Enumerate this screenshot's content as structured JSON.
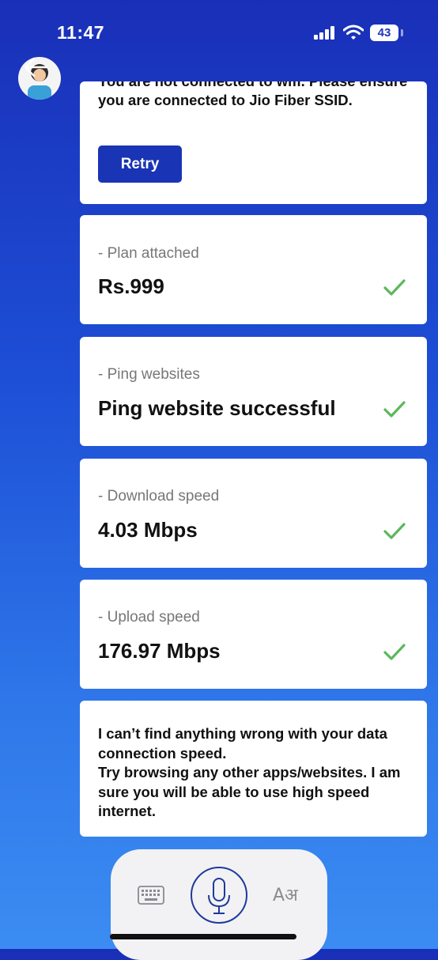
{
  "status_bar": {
    "time": "11:47",
    "battery": "43"
  },
  "colors": {
    "accent": "#1934b4",
    "check": "#5cb85c",
    "label": "#777777"
  },
  "wifi_card": {
    "message": "You are not connected to wifi. Please ensure you are connected to Jio Fiber SSID.",
    "retry_label": "Retry"
  },
  "checks": [
    {
      "label": "- Plan attached",
      "value": "Rs.999",
      "status": "checkmark-icon"
    },
    {
      "label": "- Ping websites",
      "value": "Ping website successful",
      "status": "checkmark-icon"
    },
    {
      "label": "- Download speed",
      "value": "4.03 Mbps",
      "status": "checkmark-icon"
    },
    {
      "label": "- Upload speed",
      "value": "176.97 Mbps",
      "status": "checkmark-icon"
    }
  ],
  "summary": {
    "text": "I can’t find anything wrong with your data connection speed.\nTry browsing any other apps/websites. I am sure you will be able to use high speed internet."
  },
  "bottom_bar": {
    "lang_icon": "Aअ"
  }
}
